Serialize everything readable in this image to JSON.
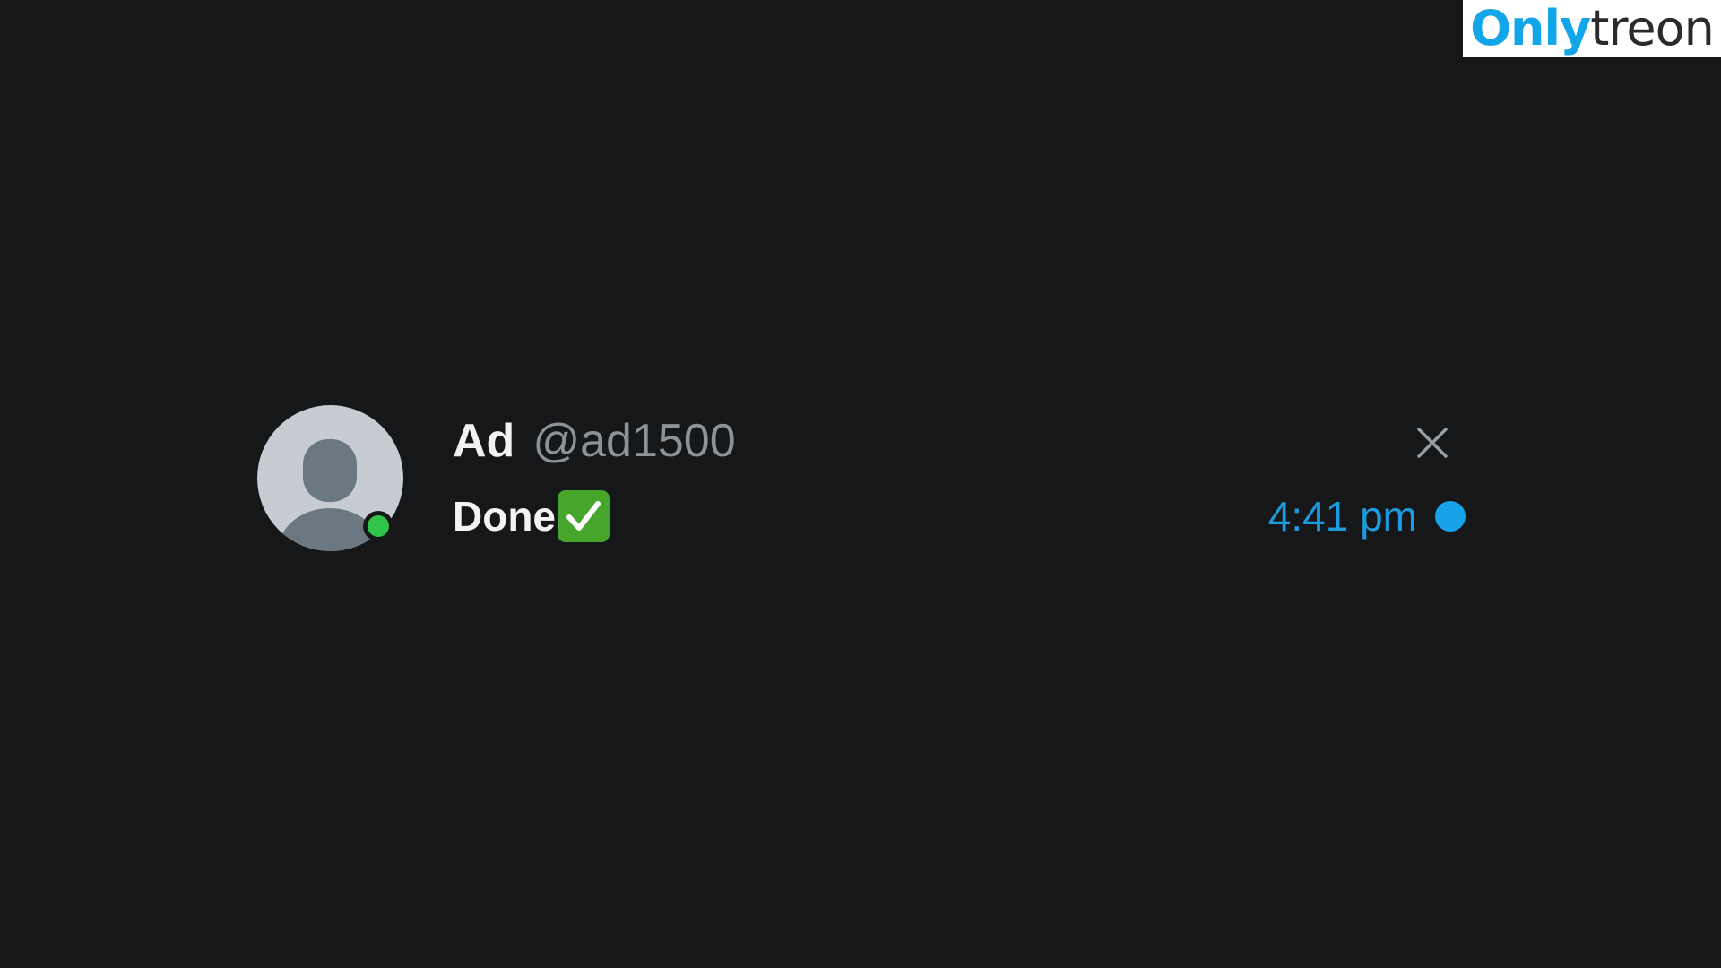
{
  "watermark": {
    "part1": "Only",
    "part2": "treon"
  },
  "notification": {
    "sender_name": "Ad",
    "sender_handle": "@ad1500",
    "message": "Done",
    "message_emoji": "check-mark-button-icon",
    "timestamp": "4:41 pm",
    "online_status_icon": "online-dot-icon",
    "unread_icon": "unread-dot-icon",
    "close_icon": "close-icon"
  },
  "colors": {
    "background": "#161719",
    "accent_blue": "#1c9be0",
    "online_green": "#31c44a",
    "emoji_green": "#46a62b",
    "handle_gray": "#8e9296",
    "avatar_gray": "#c6ccd1"
  }
}
